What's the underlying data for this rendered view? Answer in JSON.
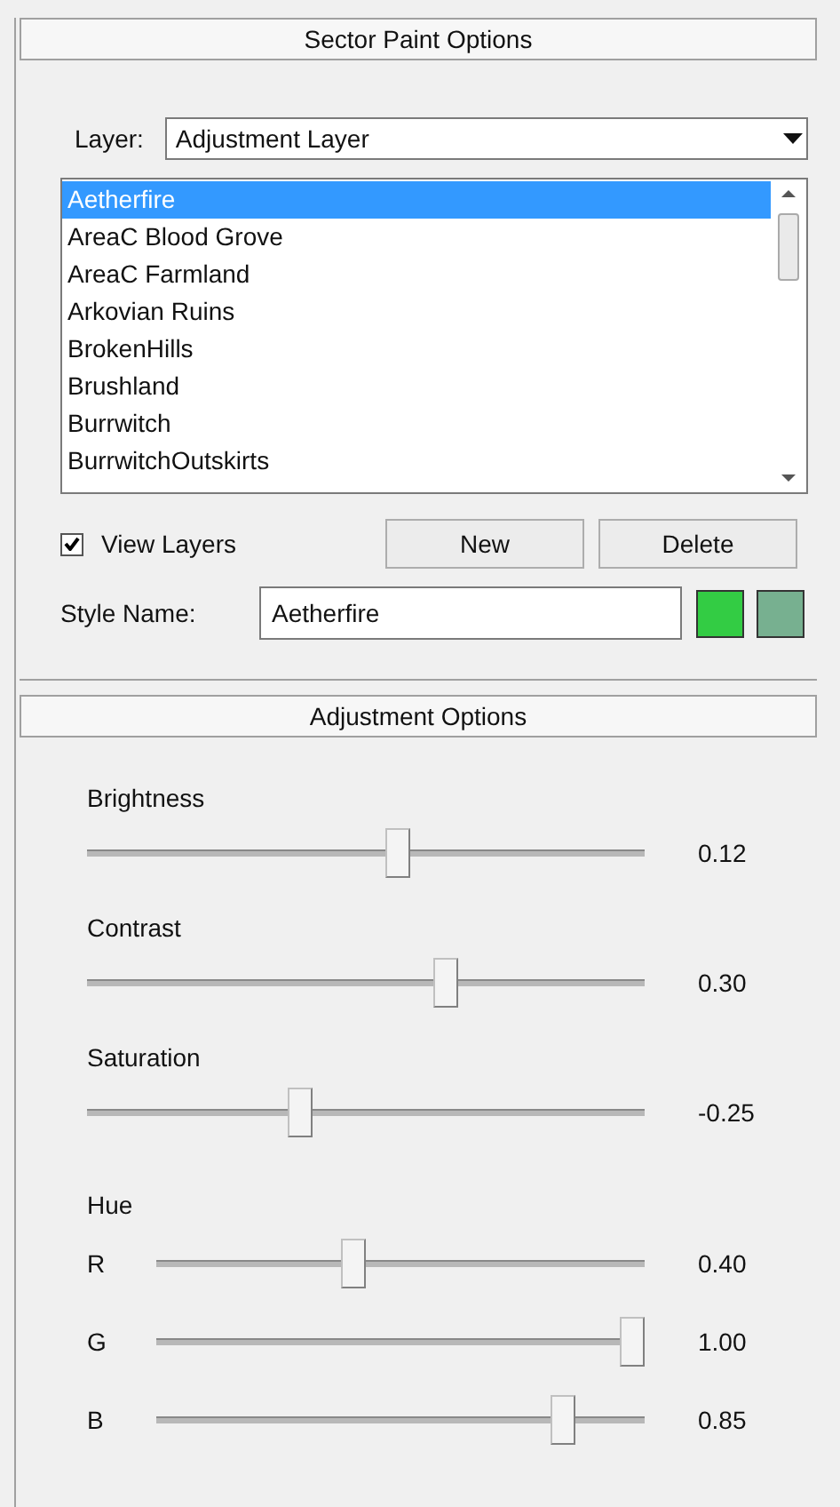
{
  "sector_panel": {
    "title": "Sector Paint Options",
    "layer": {
      "label": "Layer:",
      "value": "Adjustment Layer"
    },
    "layers": [
      {
        "label": "Aetherfire",
        "selected": true
      },
      {
        "label": "AreaC Blood Grove",
        "selected": false
      },
      {
        "label": "AreaC Farmland",
        "selected": false
      },
      {
        "label": "Arkovian Ruins",
        "selected": false
      },
      {
        "label": "BrokenHills",
        "selected": false
      },
      {
        "label": "Brushland",
        "selected": false
      },
      {
        "label": "Burrwitch",
        "selected": false
      },
      {
        "label": "BurrwitchOutskirts",
        "selected": false
      }
    ],
    "view_layers": {
      "label": "View Layers",
      "checked": true
    },
    "buttons": [
      "New",
      "Delete"
    ],
    "style_name": {
      "label": "Style Name:",
      "value": "Aetherfire"
    },
    "swatches": [
      {
        "color": "#33cc44"
      },
      {
        "color": "#77b090"
      }
    ]
  },
  "adjustment_panel": {
    "title": "Adjustment Options",
    "sliders": [
      {
        "kind": "labeled",
        "label": "Brightness",
        "level": 0.56,
        "reading": "0.12"
      },
      {
        "kind": "labeled",
        "label": "Contrast",
        "level": 0.65,
        "reading": "0.30"
      },
      {
        "kind": "labeled",
        "label": "Saturation",
        "level": 0.375,
        "reading": "-0.25"
      }
    ],
    "hue": {
      "label": "Hue",
      "channels": [
        {
          "label": "R",
          "level": 0.4,
          "reading": "0.40"
        },
        {
          "label": "G",
          "level": 1.0,
          "reading": "1.00"
        },
        {
          "label": "B",
          "level": 0.85,
          "reading": "0.85"
        }
      ]
    }
  }
}
